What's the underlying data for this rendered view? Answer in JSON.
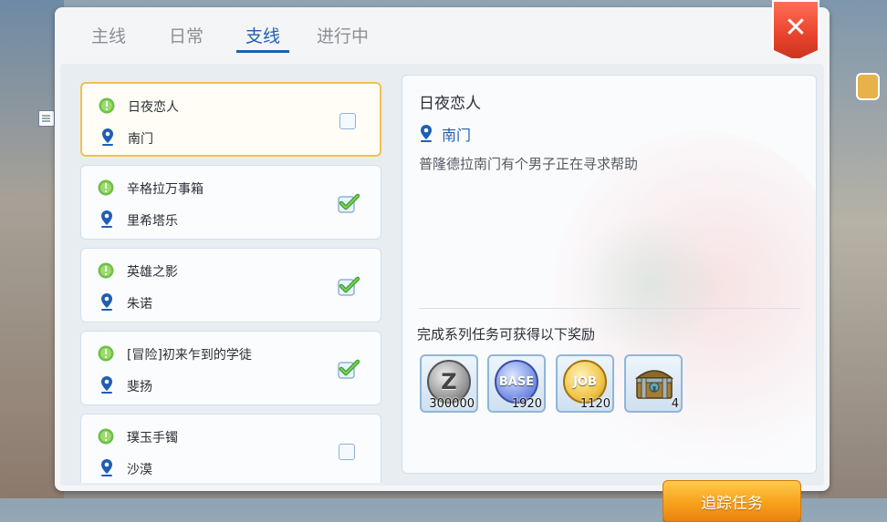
{
  "tabs": [
    {
      "label": "主线",
      "active": false
    },
    {
      "label": "日常",
      "active": false
    },
    {
      "label": "支线",
      "active": true
    },
    {
      "label": "进行中",
      "active": false
    }
  ],
  "close_symbol": "✕",
  "quests": [
    {
      "title": "日夜恋人",
      "location": "南门",
      "tracked": false,
      "selected": true
    },
    {
      "title": "辛格拉万事箱",
      "location": "里希塔乐",
      "tracked": true,
      "selected": false
    },
    {
      "title": "英雄之影",
      "location": "朱诺",
      "tracked": true,
      "selected": false
    },
    {
      "title": "[冒险]初来乍到的学徒",
      "location": "斐扬",
      "tracked": true,
      "selected": false
    },
    {
      "title": "璞玉手镯",
      "location": "沙漠",
      "tracked": false,
      "selected": false
    }
  ],
  "detail": {
    "title": "日夜恋人",
    "location": "南门",
    "description": "普隆德拉南门有个男子正在寻求帮助",
    "reward_label": "完成系列任务可获得以下奖励",
    "rewards": [
      {
        "type": "zeny",
        "icon": "zeny-coin-icon",
        "icon_text": "Z",
        "value": "300000"
      },
      {
        "type": "base",
        "icon": "base-exp-icon",
        "icon_text": "BASE",
        "value": "1920"
      },
      {
        "type": "job",
        "icon": "job-exp-icon",
        "icon_text": "JOB",
        "value": "1120"
      },
      {
        "type": "chest",
        "icon": "treasure-chest-icon",
        "icon_text": "",
        "value": "4"
      }
    ]
  },
  "track_button": "追踪任务",
  "colors": {
    "accent": "#1f5fb3",
    "selected_border": "#f2c14e",
    "close": "#e8422b",
    "button": "#f7a11c",
    "check": "#4caf50"
  }
}
